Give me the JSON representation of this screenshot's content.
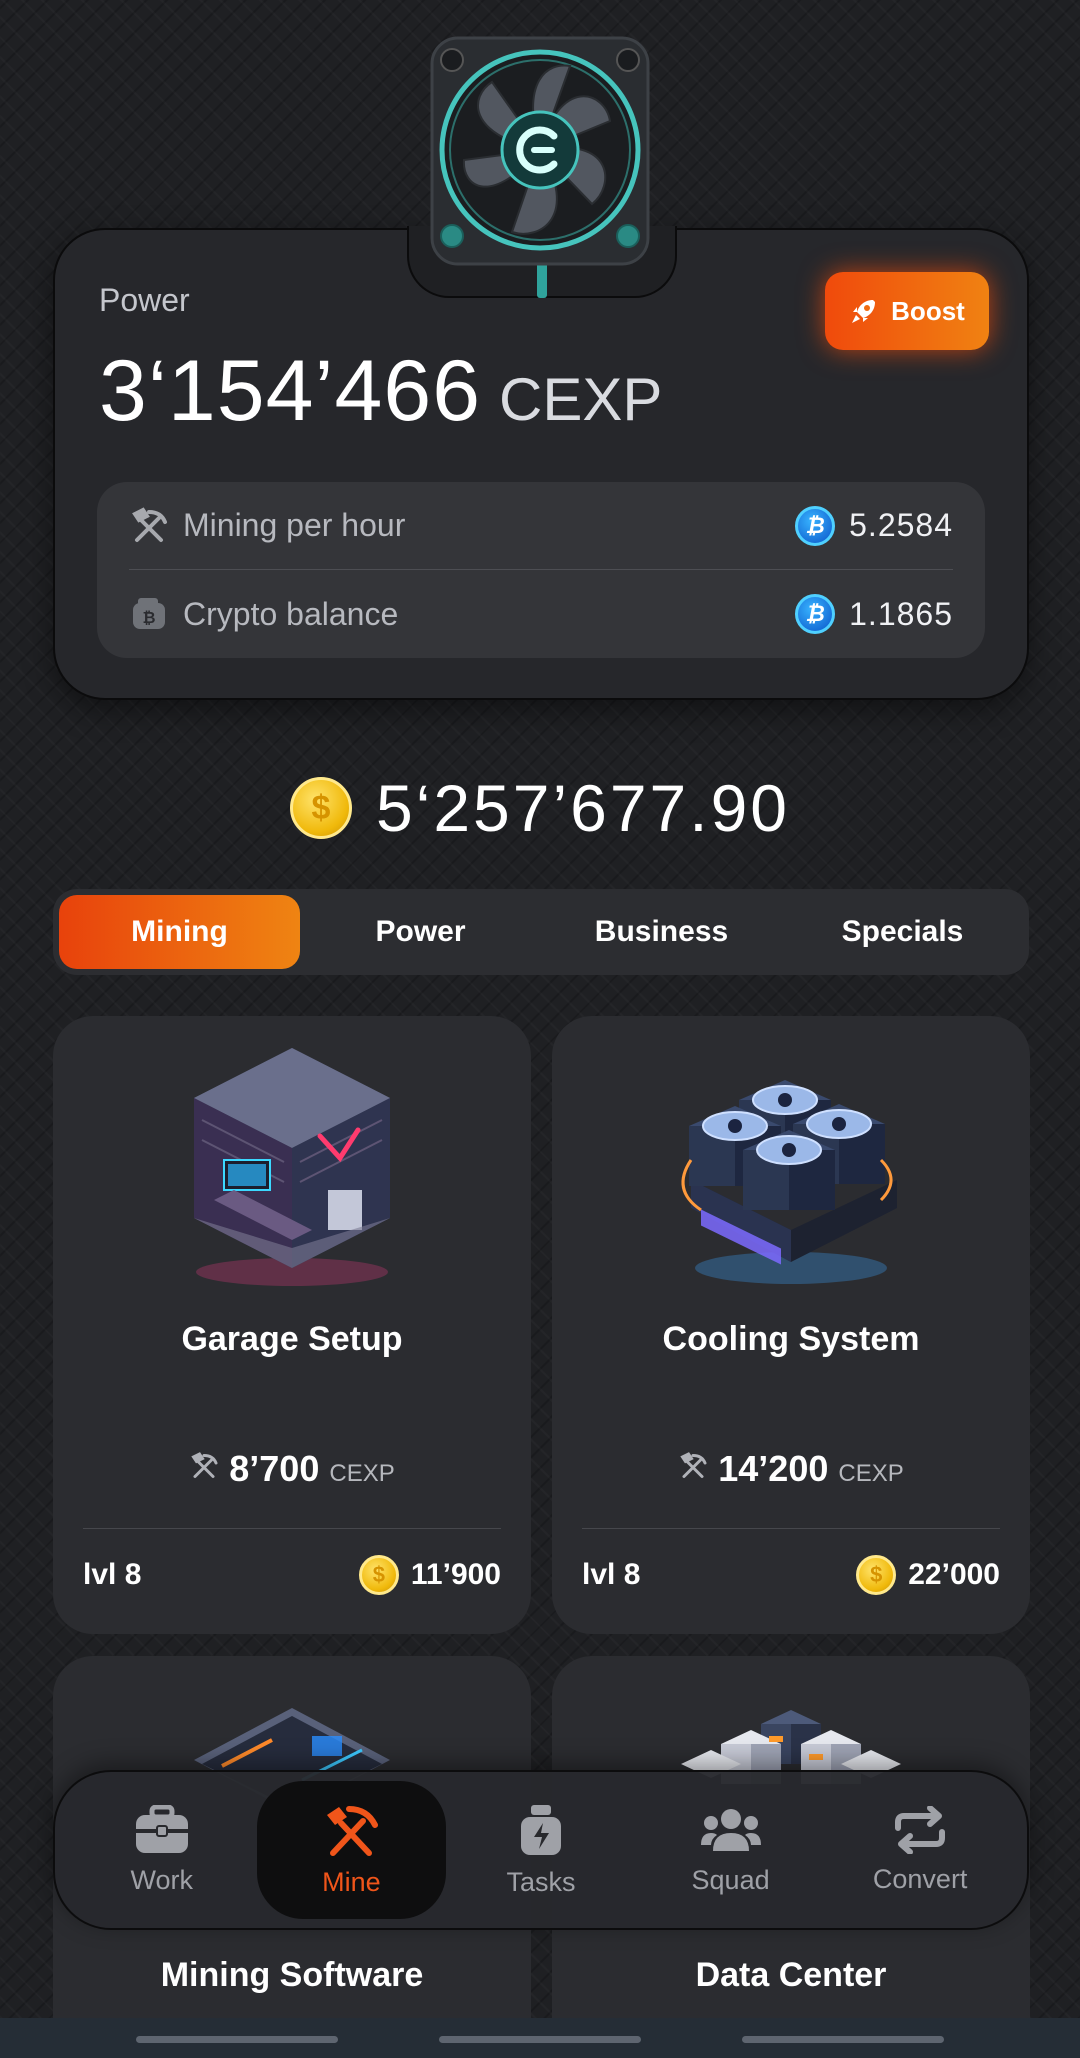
{
  "power_card": {
    "label": "Power",
    "value": "3‘154’466",
    "unit": "CEXP",
    "boost_label": "Boost",
    "stats": [
      {
        "label": "Mining per hour",
        "value": "5.2584",
        "icon": "pickaxe-hammer-icon"
      },
      {
        "label": "Crypto balance",
        "value": "1.1865",
        "icon": "wallet-bitcoin-icon"
      }
    ],
    "coin_symbol": "₿"
  },
  "balance": {
    "value": "5‘257’677.90",
    "coin_symbol": "$"
  },
  "tabs": [
    {
      "label": "Mining",
      "active": true
    },
    {
      "label": "Power",
      "active": false
    },
    {
      "label": "Business",
      "active": false
    },
    {
      "label": "Specials",
      "active": false
    }
  ],
  "cards": [
    {
      "title": "Garage Setup",
      "mining": "8’700",
      "unit": "CEXP",
      "level": "lvl 8",
      "cost": "11’900"
    },
    {
      "title": "Cooling System",
      "mining": "14’200",
      "unit": "CEXP",
      "level": "lvl 8",
      "cost": "22’000"
    },
    {
      "title": "Mining Software"
    },
    {
      "title": "Data Center"
    }
  ],
  "nav": [
    {
      "label": "Work",
      "icon": "briefcase-icon",
      "active": false
    },
    {
      "label": "Mine",
      "icon": "pickaxe-hammer-icon",
      "active": true
    },
    {
      "label": "Tasks",
      "icon": "task-bottle-icon",
      "active": false
    },
    {
      "label": "Squad",
      "icon": "people-icon",
      "active": false
    },
    {
      "label": "Convert",
      "icon": "convert-arrows-icon",
      "active": false
    }
  ],
  "colors": {
    "accent": "#f0551a",
    "accent_gradient_start": "#e8420c",
    "accent_gradient_end": "#ef8412",
    "coin_gold": "#f0b90b",
    "btc_blue": "#1c86e8"
  }
}
